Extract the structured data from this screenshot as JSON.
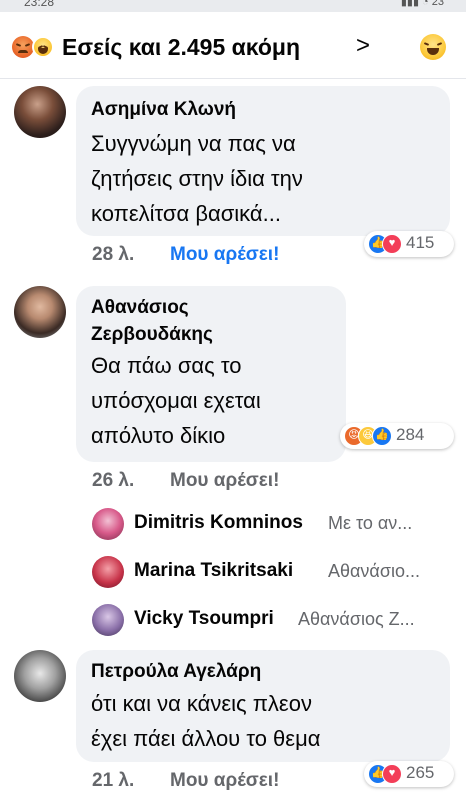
{
  "status_bar": {
    "time": "23:28",
    "icons": "▮▮▮ ◔ 23"
  },
  "header": {
    "title": "Εσείς και 2.495 ακόμη",
    "chevron": ">"
  },
  "comments": [
    {
      "author": "Ασημίνα Κλωνή",
      "text": "Συγγνώμη να πας να\nζητήσεις στην ίδια την\nκοπελίτσα βασικά...",
      "time": "28 λ.",
      "like_label": "Μου αρέσει!",
      "reaction_count": "415"
    },
    {
      "author": "Αθανάσιος\nΖερβουδάκης",
      "text": "Θα πάω σας το\nυπόσχομαι εχεται\nαπόλυτο δίκιο",
      "time": "26 λ.",
      "like_label": "Μου αρέσει!",
      "reaction_count": "284"
    },
    {
      "author": "Πετρούλα Αγελάρη",
      "text": "ότι και να κάνεις πλεον\nέχει πάει άλλου το θεμα",
      "time": "21 λ.",
      "like_label": "Μου αρέσει!",
      "reaction_count": "265"
    }
  ],
  "replies": [
    {
      "name": "Dimitris Komninos",
      "snippet": "Με το αν..."
    },
    {
      "name": "Marina Tsikritsaki",
      "snippet": "Αθανάσιο..."
    },
    {
      "name": "Vicky Tsoumpri",
      "snippet": "Αθανάσιος Ζ..."
    }
  ],
  "colors": {
    "accent_blue": "#1877f2",
    "bubble_bg": "#f0f2f5",
    "meta_gray": "#65676b",
    "love_red": "#f33e58"
  }
}
